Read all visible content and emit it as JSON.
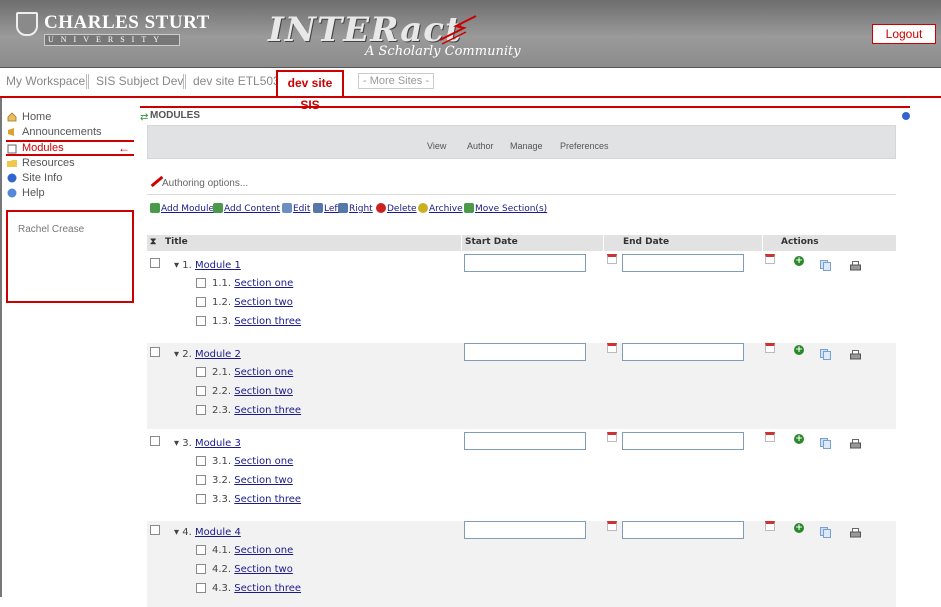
{
  "header": {
    "csu_name": "CHARLES STURT",
    "csu_university": "UNIVERSITY",
    "product_name": "INTERact",
    "product_tagline": "A Scholarly Community",
    "logout_label": "Logout",
    "accent_color": "#cc0000"
  },
  "site_tabs": [
    {
      "label": "My Workspace"
    },
    {
      "label": "SIS Subject Dev"
    },
    {
      "label": "dev site ETL503"
    },
    {
      "label": "dev site SIS",
      "active": true
    },
    {
      "label": "- More Sites -"
    }
  ],
  "sidebar": {
    "items": [
      {
        "label": "Home",
        "icon": "home-icon"
      },
      {
        "label": "Announcements",
        "icon": "announcements-icon"
      },
      {
        "label": "Modules",
        "icon": "modules-icon",
        "active": true
      },
      {
        "label": "Resources",
        "icon": "resources-icon"
      },
      {
        "label": "Site Info",
        "icon": "info-icon"
      },
      {
        "label": "Help",
        "icon": "help-icon"
      }
    ],
    "user_name": "Rachel Crease"
  },
  "portlet": {
    "title": "MODULES",
    "toolbar": {
      "view": "View",
      "author": "Author",
      "manage": "Manage",
      "preferences": "Preferences"
    },
    "authoring_label": "Authoring options...",
    "actions": {
      "add_module": "Add Module",
      "add_content": "Add Content",
      "edit": "Edit",
      "left": "Left",
      "right": "Right",
      "delete": "Delete",
      "archive": "Archive",
      "move_sections": "Move Section(s)"
    },
    "columns": {
      "sort": "⧗",
      "title": "Title",
      "start_date": "Start Date",
      "end_date": "End Date",
      "actions": "Actions"
    },
    "modules": [
      {
        "number": "1.",
        "name": "Module 1",
        "start_date": "",
        "end_date": "",
        "sections": [
          {
            "number": "1.1.",
            "name": "Section one"
          },
          {
            "number": "1.2.",
            "name": "Section two"
          },
          {
            "number": "1.3.",
            "name": "Section three"
          }
        ]
      },
      {
        "number": "2.",
        "name": "Module 2",
        "start_date": "",
        "end_date": "",
        "sections": [
          {
            "number": "2.1.",
            "name": "Section one"
          },
          {
            "number": "2.2.",
            "name": "Section two"
          },
          {
            "number": "2.3.",
            "name": "Section three"
          }
        ]
      },
      {
        "number": "3.",
        "name": "Module 3",
        "start_date": "",
        "end_date": "",
        "sections": [
          {
            "number": "3.1.",
            "name": "Section one"
          },
          {
            "number": "3.2.",
            "name": "Section two"
          },
          {
            "number": "3.3.",
            "name": "Section three"
          }
        ]
      },
      {
        "number": "4.",
        "name": "Module 4",
        "start_date": "",
        "end_date": "",
        "sections": [
          {
            "number": "4.1.",
            "name": "Section one"
          },
          {
            "number": "4.2.",
            "name": "Section two"
          },
          {
            "number": "4.3.",
            "name": "Section three"
          }
        ]
      }
    ]
  }
}
